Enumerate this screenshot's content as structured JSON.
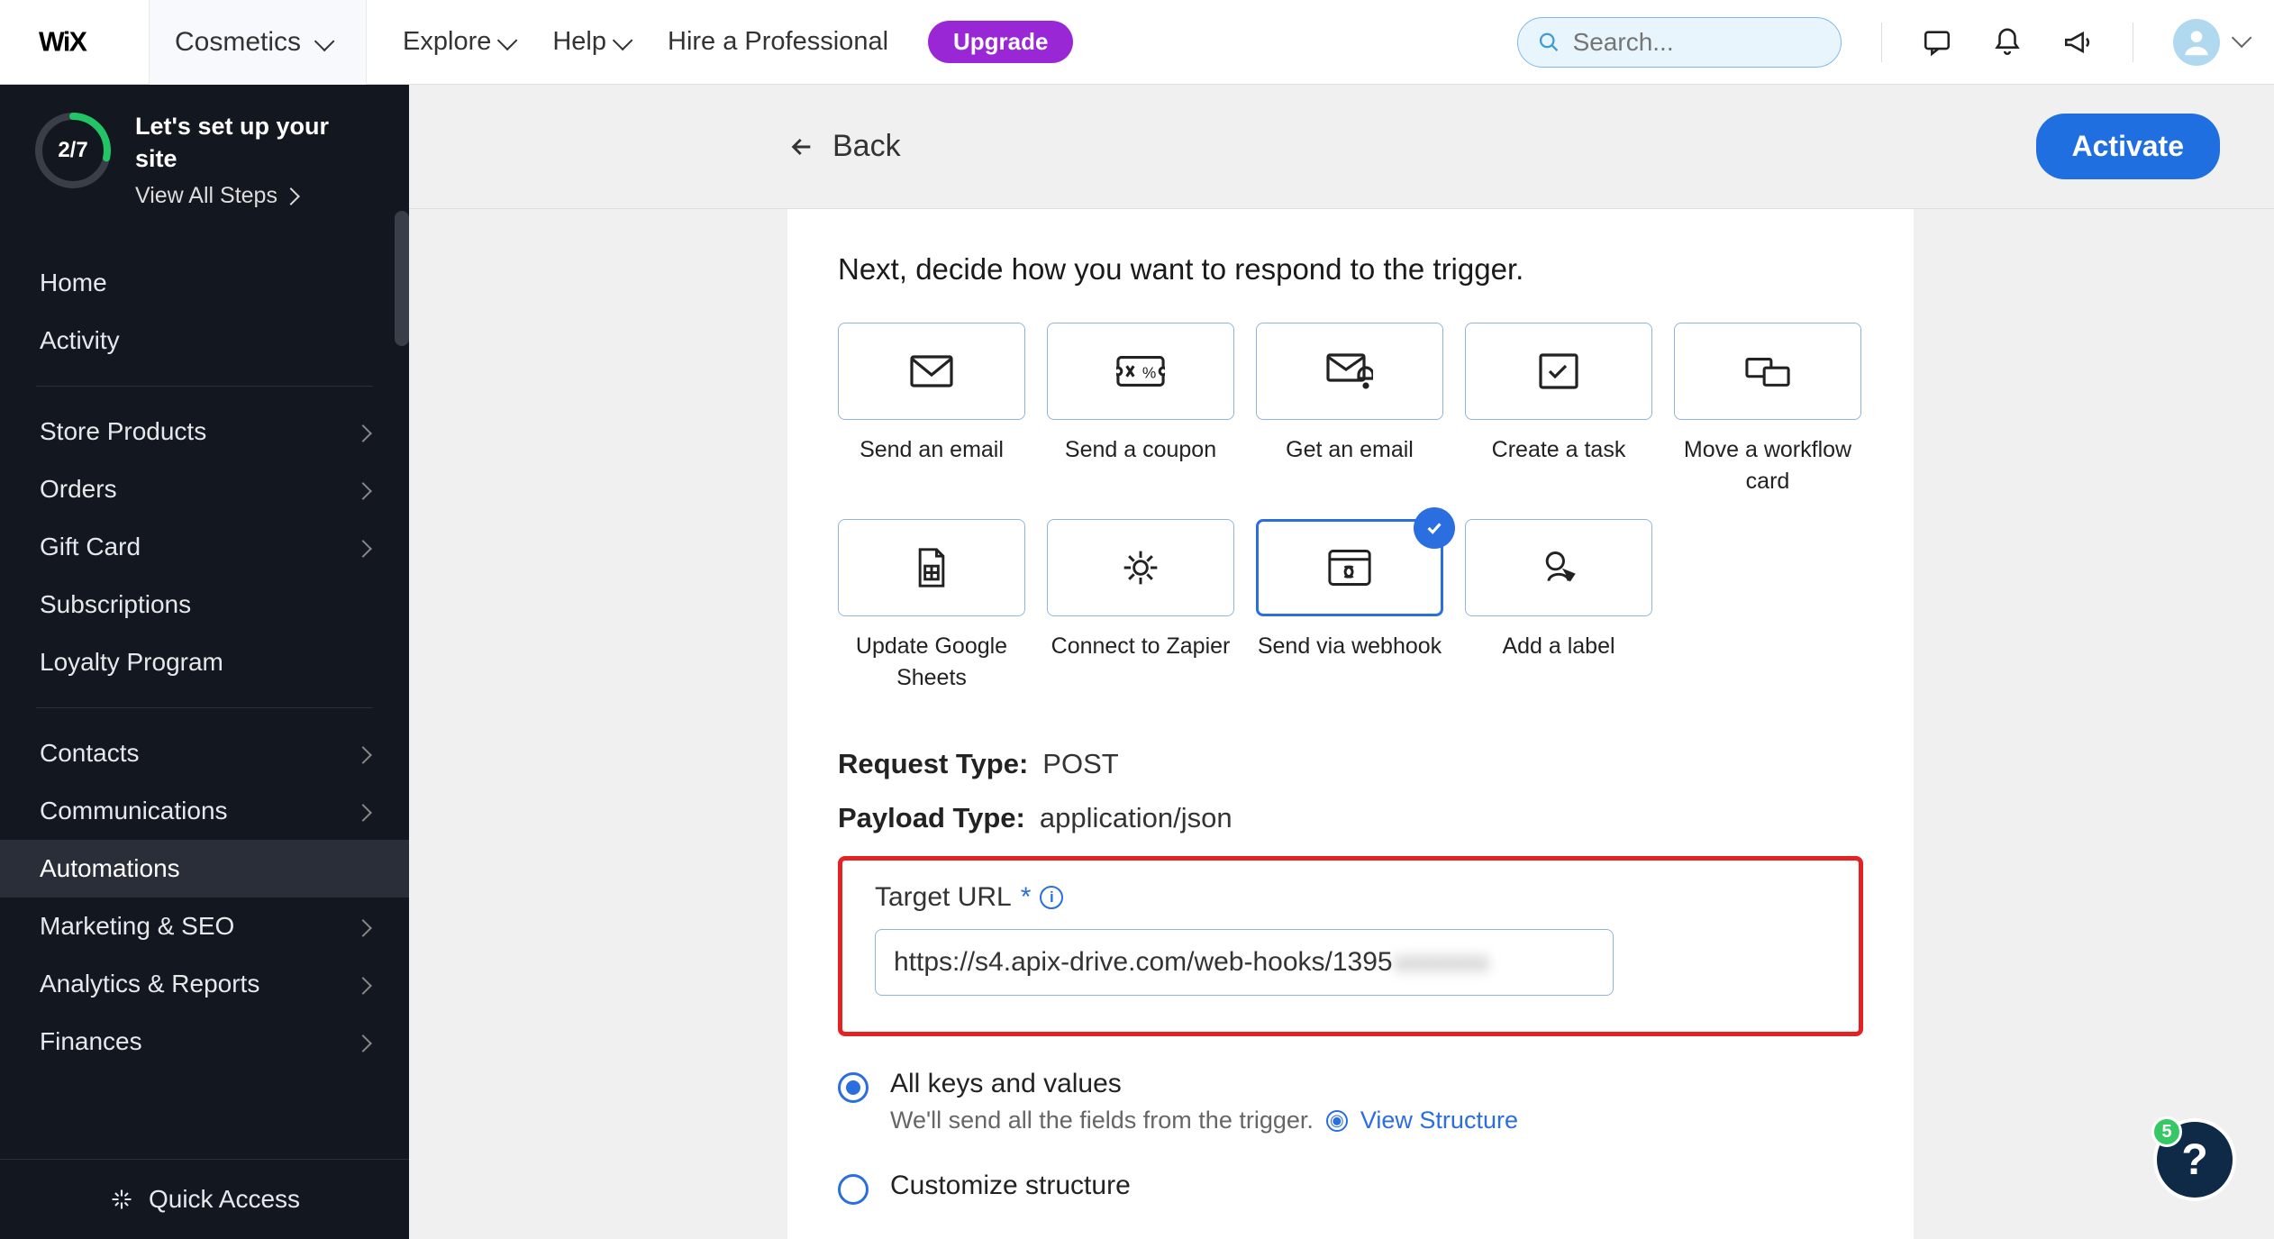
{
  "topbar": {
    "site_name": "Cosmetics",
    "nav": {
      "explore": "Explore",
      "help": "Help",
      "hire": "Hire a Professional"
    },
    "upgrade": "Upgrade",
    "search_placeholder": "Search..."
  },
  "sidebar": {
    "setup": {
      "progress_text": "2/7",
      "title": "Let's set up your site",
      "link": "View All Steps"
    },
    "items_top": [
      "Home",
      "Activity"
    ],
    "items_store": [
      "Store Products",
      "Orders",
      "Gift Card",
      "Subscriptions",
      "Loyalty Program"
    ],
    "has_chevron_store": [
      true,
      true,
      true,
      false,
      false
    ],
    "items_mktg": [
      "Contacts",
      "Communications",
      "Automations",
      "Marketing & SEO",
      "Analytics & Reports",
      "Finances"
    ],
    "has_chevron_mktg": [
      true,
      true,
      false,
      true,
      true,
      true
    ],
    "active_index": 2,
    "quick_access": "Quick Access"
  },
  "header": {
    "back": "Back",
    "activate": "Activate"
  },
  "card": {
    "heading": "Next, decide how you want to respond to the trigger.",
    "actions_row1": [
      "Send an email",
      "Send a coupon",
      "Get an email",
      "Create a task",
      "Move a workflow card"
    ],
    "actions_row2": [
      "Update Google Sheets",
      "Connect to Zapier",
      "Send via webhook",
      "Add a label"
    ],
    "selected": "Send via webhook",
    "request_type_label": "Request Type:",
    "request_type_value": "POST",
    "payload_type_label": "Payload Type:",
    "payload_type_value": "application/json",
    "target_url_label": "Target URL",
    "target_url_value": "https://s4.apix-drive.com/web-hooks/1395",
    "target_url_redacted": "xxxxxxx",
    "radio_all_label": "All keys and values",
    "radio_all_sub": "We'll send all the fields from the trigger.",
    "view_structure": "View Structure",
    "radio_custom_label": "Customize structure"
  },
  "help": {
    "badge": "5",
    "symbol": "?"
  }
}
